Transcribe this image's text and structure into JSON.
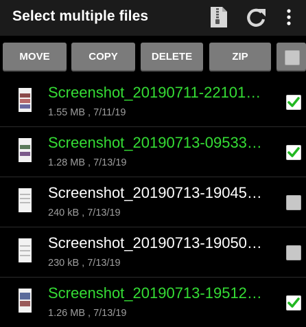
{
  "appbar": {
    "title": "Select multiple files",
    "actions": [
      {
        "icon": "zip-file-icon"
      },
      {
        "icon": "refresh-icon"
      },
      {
        "icon": "more-vert-icon"
      }
    ]
  },
  "toolbar": {
    "move_label": "MOVE",
    "copy_label": "COPY",
    "delete_label": "DELETE",
    "zip_label": "ZIP",
    "select_all_checked": false
  },
  "colors": {
    "selected_text": "#35dd35",
    "checkbox_check": "#22b822",
    "button_bg": "#7b7b7b"
  },
  "files": [
    {
      "name": "Screenshot_20190711-22101…",
      "meta": "1.55 MB , 7/11/19",
      "selected": true
    },
    {
      "name": "Screenshot_20190713-09533…",
      "meta": "1.28 MB , 7/13/19",
      "selected": true
    },
    {
      "name": "Screenshot_20190713-19045…",
      "meta": "240 kB , 7/13/19",
      "selected": false
    },
    {
      "name": "Screenshot_20190713-19050…",
      "meta": "230 kB , 7/13/19",
      "selected": false
    },
    {
      "name": "Screenshot_20190713-19512…",
      "meta": "1.26 MB , 7/13/19",
      "selected": true
    }
  ]
}
